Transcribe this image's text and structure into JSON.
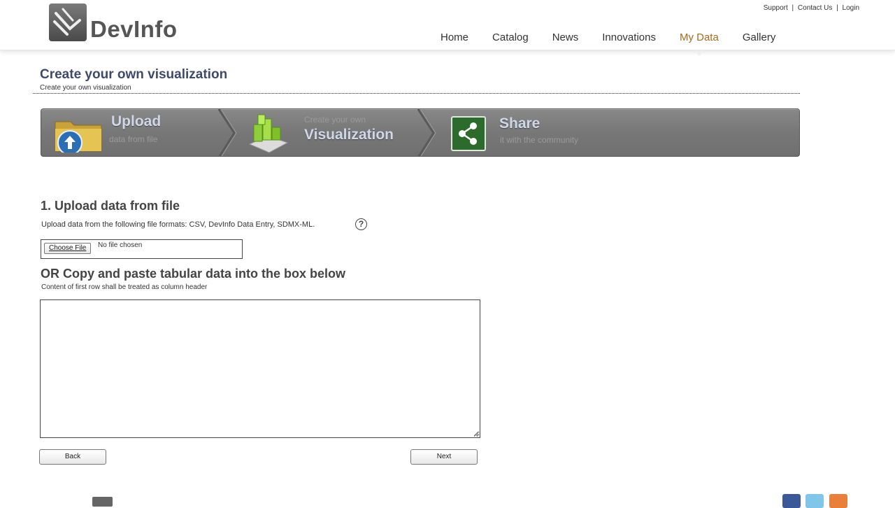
{
  "brand": {
    "name": "DevInfo"
  },
  "toplinks": [
    "Support",
    "Contact Us",
    "Login"
  ],
  "nav": [
    {
      "label": "Home",
      "active": false
    },
    {
      "label": "Catalog",
      "active": false
    },
    {
      "label": "News",
      "active": false
    },
    {
      "label": "Innovations",
      "active": false
    },
    {
      "label": "My Data",
      "active": true
    },
    {
      "label": "Gallery",
      "active": false
    }
  ],
  "page": {
    "title": "Create your own visualization",
    "subtitle": "Create your own visualization"
  },
  "steps": [
    {
      "title": "Upload",
      "subtitle": "data from file",
      "icon": "folder-upload-icon"
    },
    {
      "pretitle": "Create your own",
      "title": "Visualization",
      "icon": "chart-boxes-icon"
    },
    {
      "title": "Share",
      "subtitle": "it with the community",
      "icon": "share-icon"
    }
  ],
  "upload": {
    "title": "1. Upload data from file",
    "description": "Upload data from the following file formats: CSV, DevInfo Data Entry, SDMX-ML.",
    "help": "?",
    "choose_label": "Choose File",
    "file_status": "No file chosen"
  },
  "paste": {
    "title": "OR Copy and paste tabular data into the box below",
    "description": "Content of first row shall be treated as column header",
    "value": ""
  },
  "buttons": {
    "back": "Back",
    "next": "Next"
  },
  "colors": {
    "nav_active": "#a86a1c",
    "title": "#3f4a6b",
    "banner": "#7a7a7a"
  }
}
